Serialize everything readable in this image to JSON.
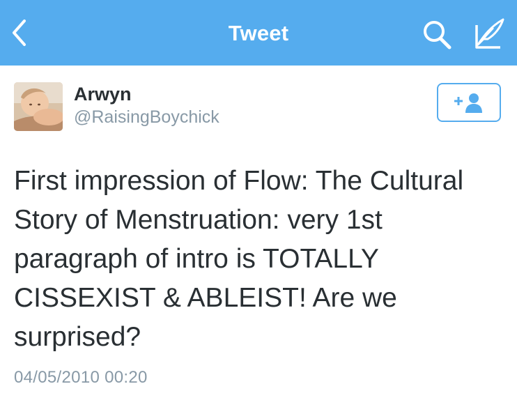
{
  "nav": {
    "title": "Tweet",
    "back_icon": "chevron-left-icon",
    "search_icon": "search-icon",
    "compose_icon": "compose-quill-icon",
    "bar_color": "#55acee"
  },
  "author": {
    "name": "Arwyn",
    "handle": "@RaisingBoychick",
    "follow_icon": "add-user-icon"
  },
  "tweet": {
    "text": "First impression of Flow: The Cultural Story of Menstruation: very 1st paragraph of intro is TOTALLY CISSEXIST & ABLEIST! Are we surprised?",
    "timestamp": "04/05/2010 00:20"
  },
  "colors": {
    "accent": "#55acee",
    "text_primary": "#292f33",
    "text_secondary": "#8899a6"
  }
}
